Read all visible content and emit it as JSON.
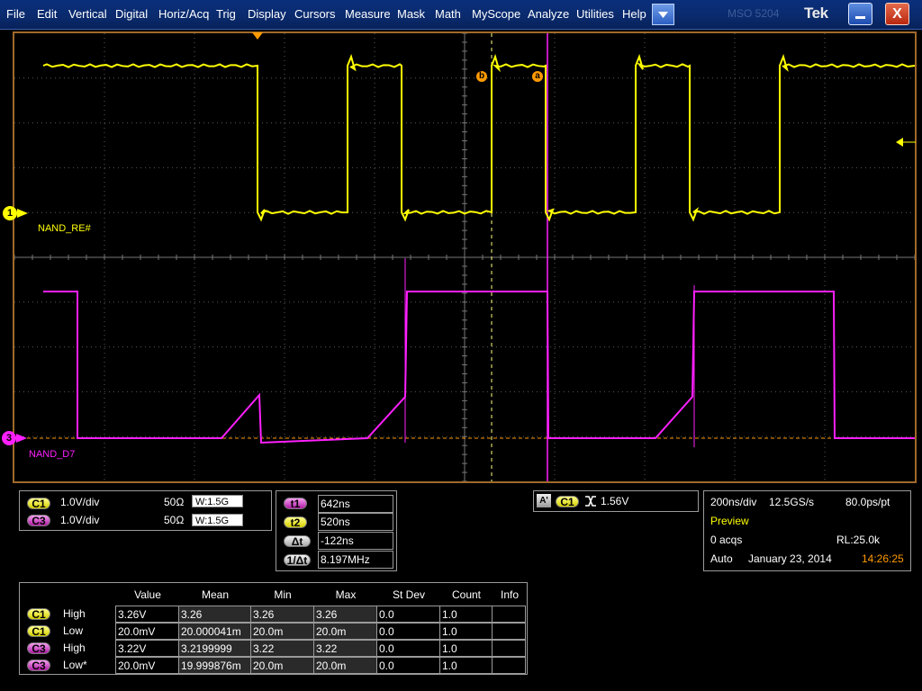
{
  "menu": {
    "items": [
      "File",
      "Edit",
      "Vertical",
      "Digital",
      "Horiz/Acq",
      "Trig",
      "Display",
      "Cursors",
      "Measure",
      "Mask",
      "Math",
      "MyScope",
      "Analyze",
      "Utilities",
      "Help"
    ],
    "model": "MSO 5204",
    "logo": "Tek",
    "close_label": "X"
  },
  "display": {
    "ch1_marker": "1",
    "ch3_marker": "3",
    "ch1_name": "NAND_RE#",
    "ch3_name": "NAND_D7",
    "cursor_b_label": "b",
    "cursor_a_label": "a",
    "colors": {
      "ch1": "#ffff00",
      "ch3": "#ff20ff",
      "cursor": "#ff9a00",
      "grid": "#5a5a5a"
    }
  },
  "channel_panel": {
    "rows": [
      {
        "pill": "C1",
        "scale": "1.0V/div",
        "impedance": "50Ω",
        "bw_prefix": "W",
        "bw_value": ":1.5G"
      },
      {
        "pill": "C3",
        "scale": "1.0V/div",
        "impedance": "50Ω",
        "bw_prefix": "W",
        "bw_value": ":1.5G"
      }
    ]
  },
  "cursor_panel": {
    "rows": [
      {
        "pill": "t1",
        "value": "642ns"
      },
      {
        "pill": "t2",
        "value": "520ns"
      },
      {
        "pill": "Δt",
        "value": "-122ns"
      },
      {
        "pill": "1/Δt",
        "value": "8.197MHz"
      }
    ]
  },
  "trigger_panel": {
    "mode": "A'",
    "source": "C1",
    "level": "1.56V"
  },
  "acq_panel": {
    "timebase": "200ns/div",
    "sample_rate": "12.5GS/s",
    "resolution": "80.0ps/pt",
    "state": "Preview",
    "acqs": "0 acqs",
    "record_length": "RL:25.0k",
    "trigger_mode": "Auto",
    "date": "January 23, 2014",
    "time": "14:26:25"
  },
  "measurements": {
    "headers": [
      "Value",
      "Mean",
      "Min",
      "Max",
      "St Dev",
      "Count",
      "Info"
    ],
    "rows": [
      {
        "source": "C1",
        "name": "High",
        "cells": [
          "3.26V",
          "3.26",
          "3.26",
          "3.26",
          "0.0",
          "1.0",
          ""
        ]
      },
      {
        "source": "C1",
        "name": "Low",
        "cells": [
          "20.0mV",
          "20.000041m",
          "20.0m",
          "20.0m",
          "0.0",
          "1.0",
          ""
        ]
      },
      {
        "source": "C3",
        "name": "High",
        "cells": [
          "3.22V",
          "3.2199999",
          "3.22",
          "3.22",
          "0.0",
          "1.0",
          ""
        ]
      },
      {
        "source": "C3",
        "name": "Low*",
        "cells": [
          "20.0mV",
          "19.999876m",
          "20.0m",
          "20.0m",
          "0.0",
          "1.0",
          ""
        ]
      }
    ]
  }
}
